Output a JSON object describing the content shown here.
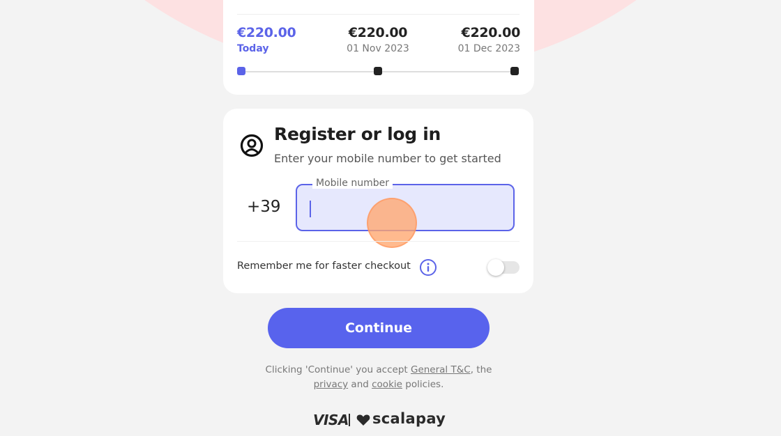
{
  "plan": {
    "installments": [
      {
        "amount": "€220.00",
        "date": "Today"
      },
      {
        "amount": "€220.00",
        "date": "01 Nov 2023"
      },
      {
        "amount": "€220.00",
        "date": "01 Dec 2023"
      }
    ]
  },
  "login": {
    "title": "Register or log in",
    "subtitle": "Enter your mobile number to get started",
    "country_code": "+39",
    "mobile_label": "Mobile number",
    "mobile_value": "",
    "remember_label": "Remember me for faster checkout",
    "remember_enabled": false
  },
  "continue_label": "Continue",
  "terms": {
    "prefix": "Clicking 'Continue' you accept ",
    "general_link": "General T&C",
    "middle": ", the",
    "privacy_link": "privacy",
    "and_text": " and ",
    "cookie_link": "cookie",
    "suffix": " policies."
  },
  "footer": {
    "visa": "VISA",
    "brand": "scalapay"
  },
  "colors": {
    "accent": "#5b63e8",
    "background_circle": "#fde1e2",
    "touch_indicator": "#ffa66e"
  },
  "icons": [
    "user-circle-icon",
    "info-icon",
    "heart-icon"
  ]
}
